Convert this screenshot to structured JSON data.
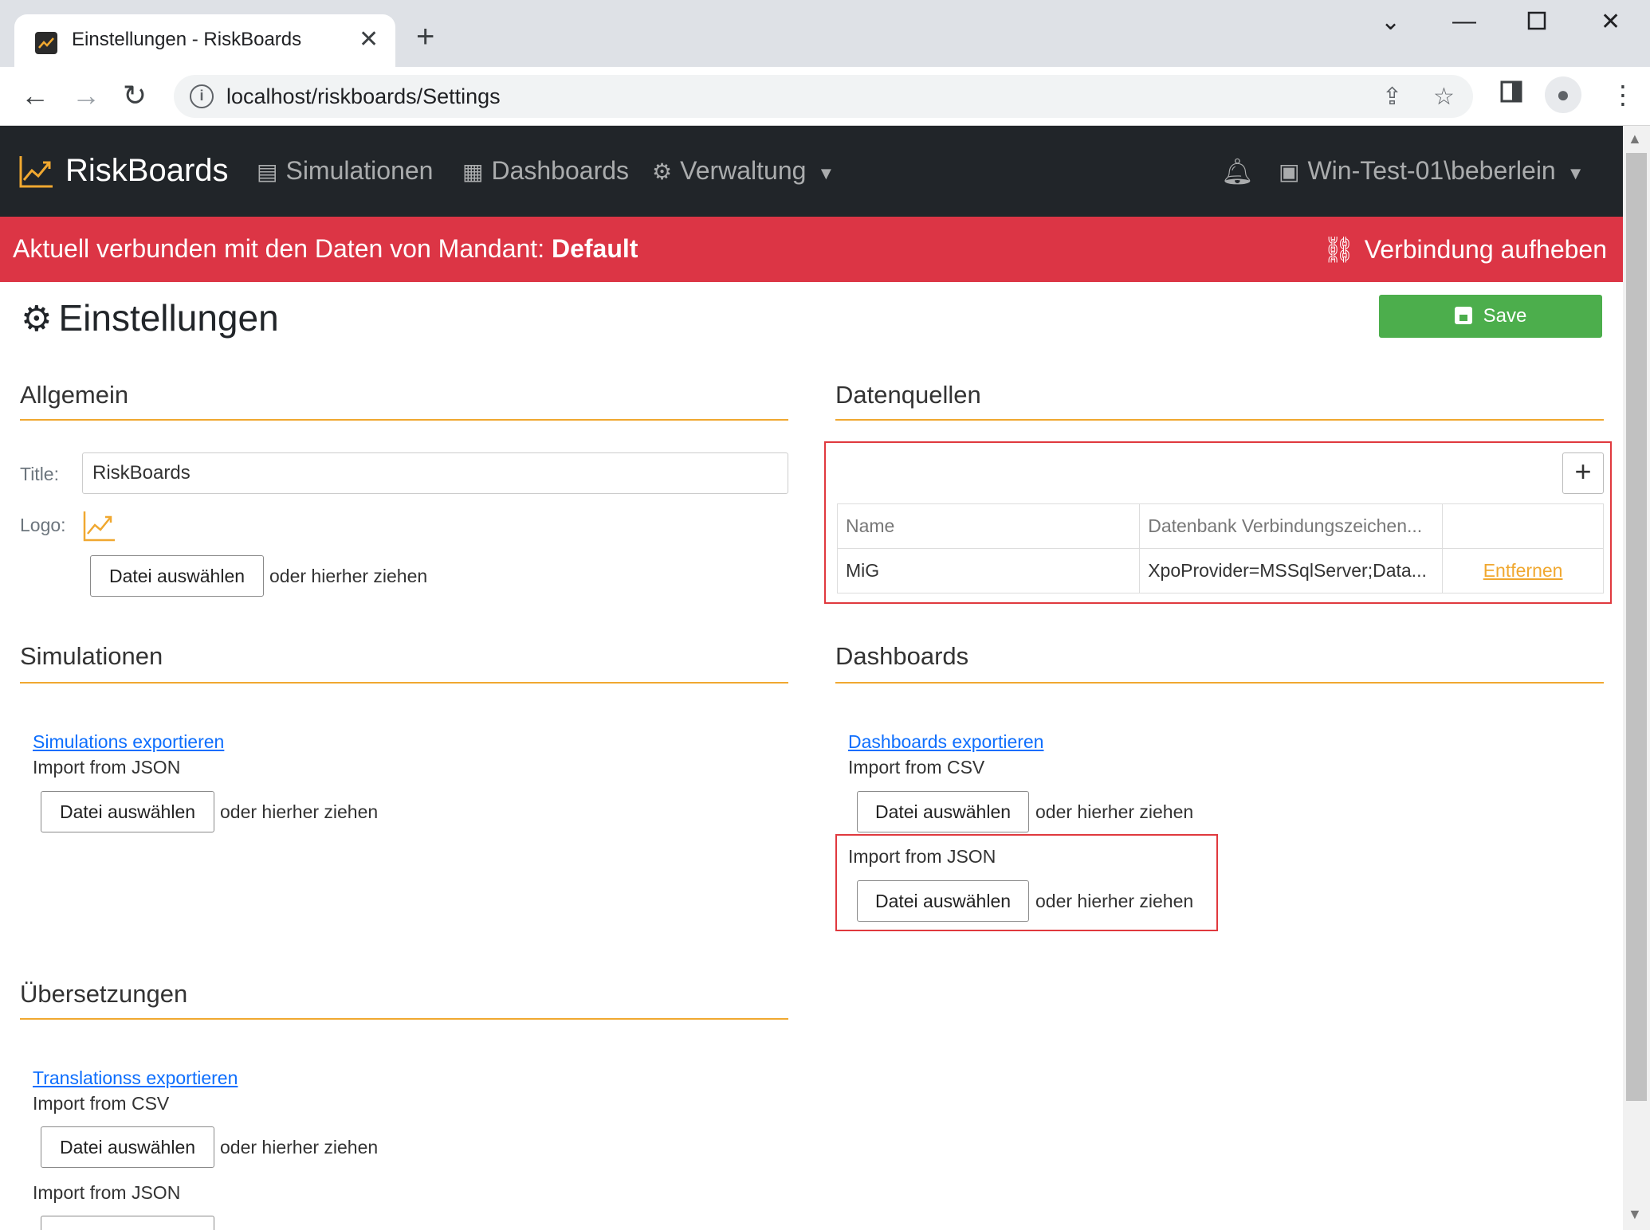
{
  "browser": {
    "tab_title": "Einstellungen - RiskBoards",
    "url": "localhost/riskboards/Settings"
  },
  "navbar": {
    "brand": "RiskBoards",
    "items": [
      {
        "label": "Simulationen",
        "icon": "database-icon"
      },
      {
        "label": "Dashboards",
        "icon": "dashboard-grid-icon"
      },
      {
        "label": "Verwaltung",
        "icon": "gear-icon"
      }
    ],
    "user": "Win-Test-01\\beberlein"
  },
  "banner": {
    "text": "Aktuell verbunden mit den Daten von Mandant:",
    "tenant": "Default",
    "disconnect": "Verbindung aufheben",
    "color": "#dc3545"
  },
  "page": {
    "title": "Einstellungen",
    "save": "Save"
  },
  "allgemein": {
    "title": "Allgemein",
    "title_label": "Title:",
    "title_value": "RiskBoards",
    "logo_label": "Logo:",
    "file_button": "Datei auswählen",
    "drop_text": "oder hierher ziehen"
  },
  "datenquellen": {
    "title": "Datenquellen",
    "add": "+",
    "columns": [
      "Name",
      "Datenbank Verbindungszeichen...",
      ""
    ],
    "rows": [
      {
        "name": "MiG",
        "connection": "XpoProvider=MSSqlServer;Data...",
        "action": "Entfernen"
      }
    ]
  },
  "simulationen": {
    "title": "Simulationen",
    "export_link": "Simulations exportieren",
    "import_json": "Import from JSON",
    "file_button": "Datei auswählen",
    "drop_text": "oder hierher ziehen"
  },
  "dashboards": {
    "title": "Dashboards",
    "export_link": "Dashboards exportieren",
    "import_csv": "Import from CSV",
    "import_json": "Import from JSON",
    "file_button": "Datei auswählen",
    "drop_text": "oder hierher ziehen"
  },
  "uebersetzungen": {
    "title": "Übersetzungen",
    "export_link": "Translationss exportieren",
    "import_csv": "Import from CSV",
    "import_json": "Import from JSON",
    "file_button": "Datei auswählen",
    "drop_text": "oder hierher ziehen"
  },
  "colors": {
    "accent": "#f0a830",
    "success": "#4cae4c",
    "navbar": "#212529",
    "highlight": "#e0393e"
  }
}
